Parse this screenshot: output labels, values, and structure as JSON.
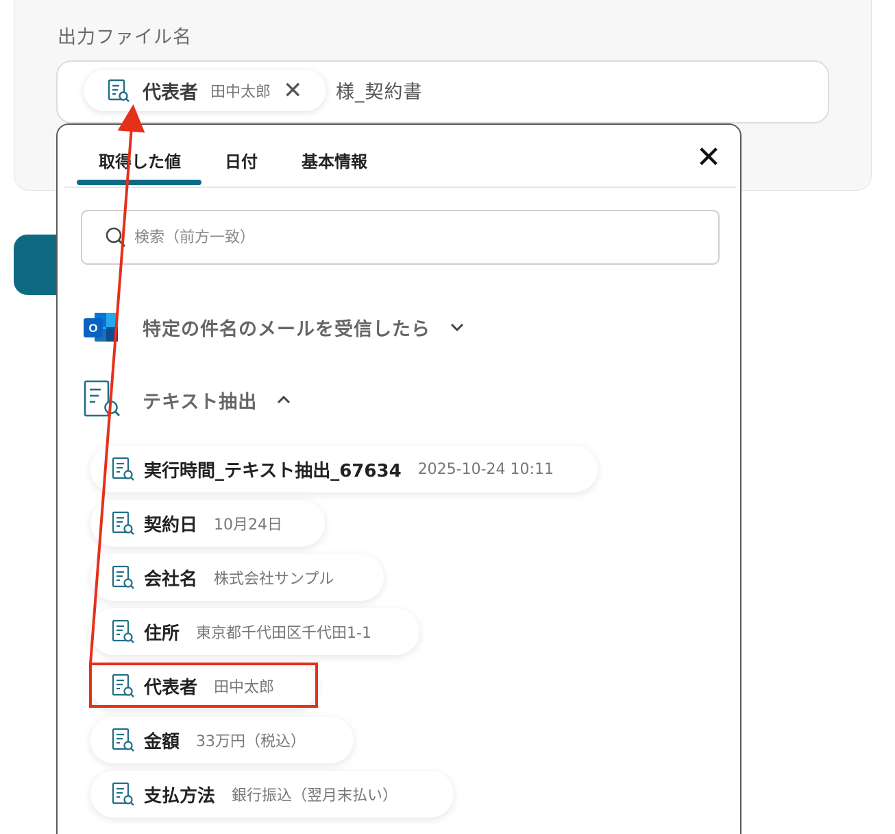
{
  "field": {
    "label": "出力ファイル名",
    "chip": {
      "key": "代表者",
      "value": "田中太郎"
    },
    "suffix": "様_契約書"
  },
  "tabs": [
    {
      "label": "取得した値",
      "active": true
    },
    {
      "label": "日付"
    },
    {
      "label": "基本情報"
    }
  ],
  "search": {
    "placeholder": "検索（前方一致）"
  },
  "sections": [
    {
      "title": "特定の件名のメールを受信したら",
      "icon": "outlook-icon",
      "state": "collapsed"
    },
    {
      "title": "テキスト抽出",
      "icon": "text-extract-icon",
      "state": "expanded"
    }
  ],
  "items": [
    {
      "key": "実行時間_テキスト抽出_67634",
      "value": "2025-10-24 10:11"
    },
    {
      "key": "契約日",
      "value": "10月24日"
    },
    {
      "key": "会社名",
      "value": "株式会社サンプル"
    },
    {
      "key": "住所",
      "value": "東京都千代田区千代田1-1"
    },
    {
      "key": "代表者",
      "value": "田中太郎",
      "highlighted": true
    },
    {
      "key": "金額",
      "value": "33万円（税込）"
    },
    {
      "key": "支払方法",
      "value": "銀行振込（翌月末払い）"
    }
  ],
  "colors": {
    "accent": "#0e6a82",
    "annotation": "#e5311a"
  }
}
